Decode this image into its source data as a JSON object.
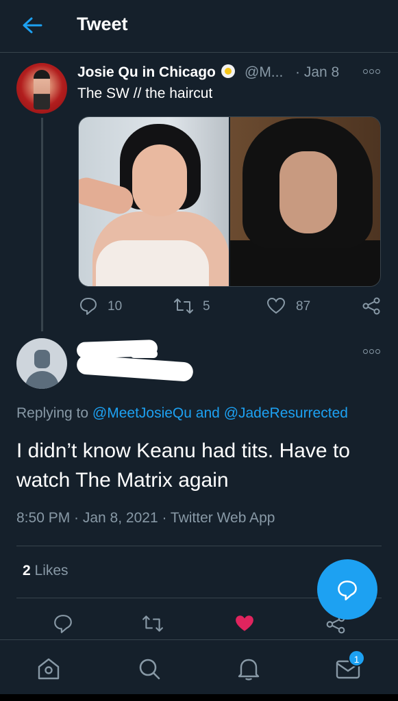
{
  "header": {
    "title": "Tweet",
    "back_icon": "arrow-left-icon"
  },
  "tweet": {
    "author_name": "Josie Qu in Chicago",
    "author_handle": "@M...",
    "date": "· Jan 8",
    "text": "The SW // the haircut",
    "stats": {
      "replies": "10",
      "retweets": "5",
      "likes": "87"
    }
  },
  "reply": {
    "replying_prefix": "Replying to",
    "mention_1": "@MeetJosieQu",
    "conjunction": "and",
    "mention_2": "@JadeResurrected",
    "text": "I didn’t know Keanu had tits.  Have to watch The Matrix again",
    "timestamp": "8:50 PM · Jan 8, 2021 · Twitter Web App",
    "likes_count": "2",
    "likes_label": "Likes"
  },
  "bottom_nav": {
    "notification_badge": "1"
  },
  "colors": {
    "background": "#15202b",
    "accent": "#1da1f2",
    "like": "#e0245e",
    "muted": "#8899a6",
    "divider": "#38444d"
  }
}
